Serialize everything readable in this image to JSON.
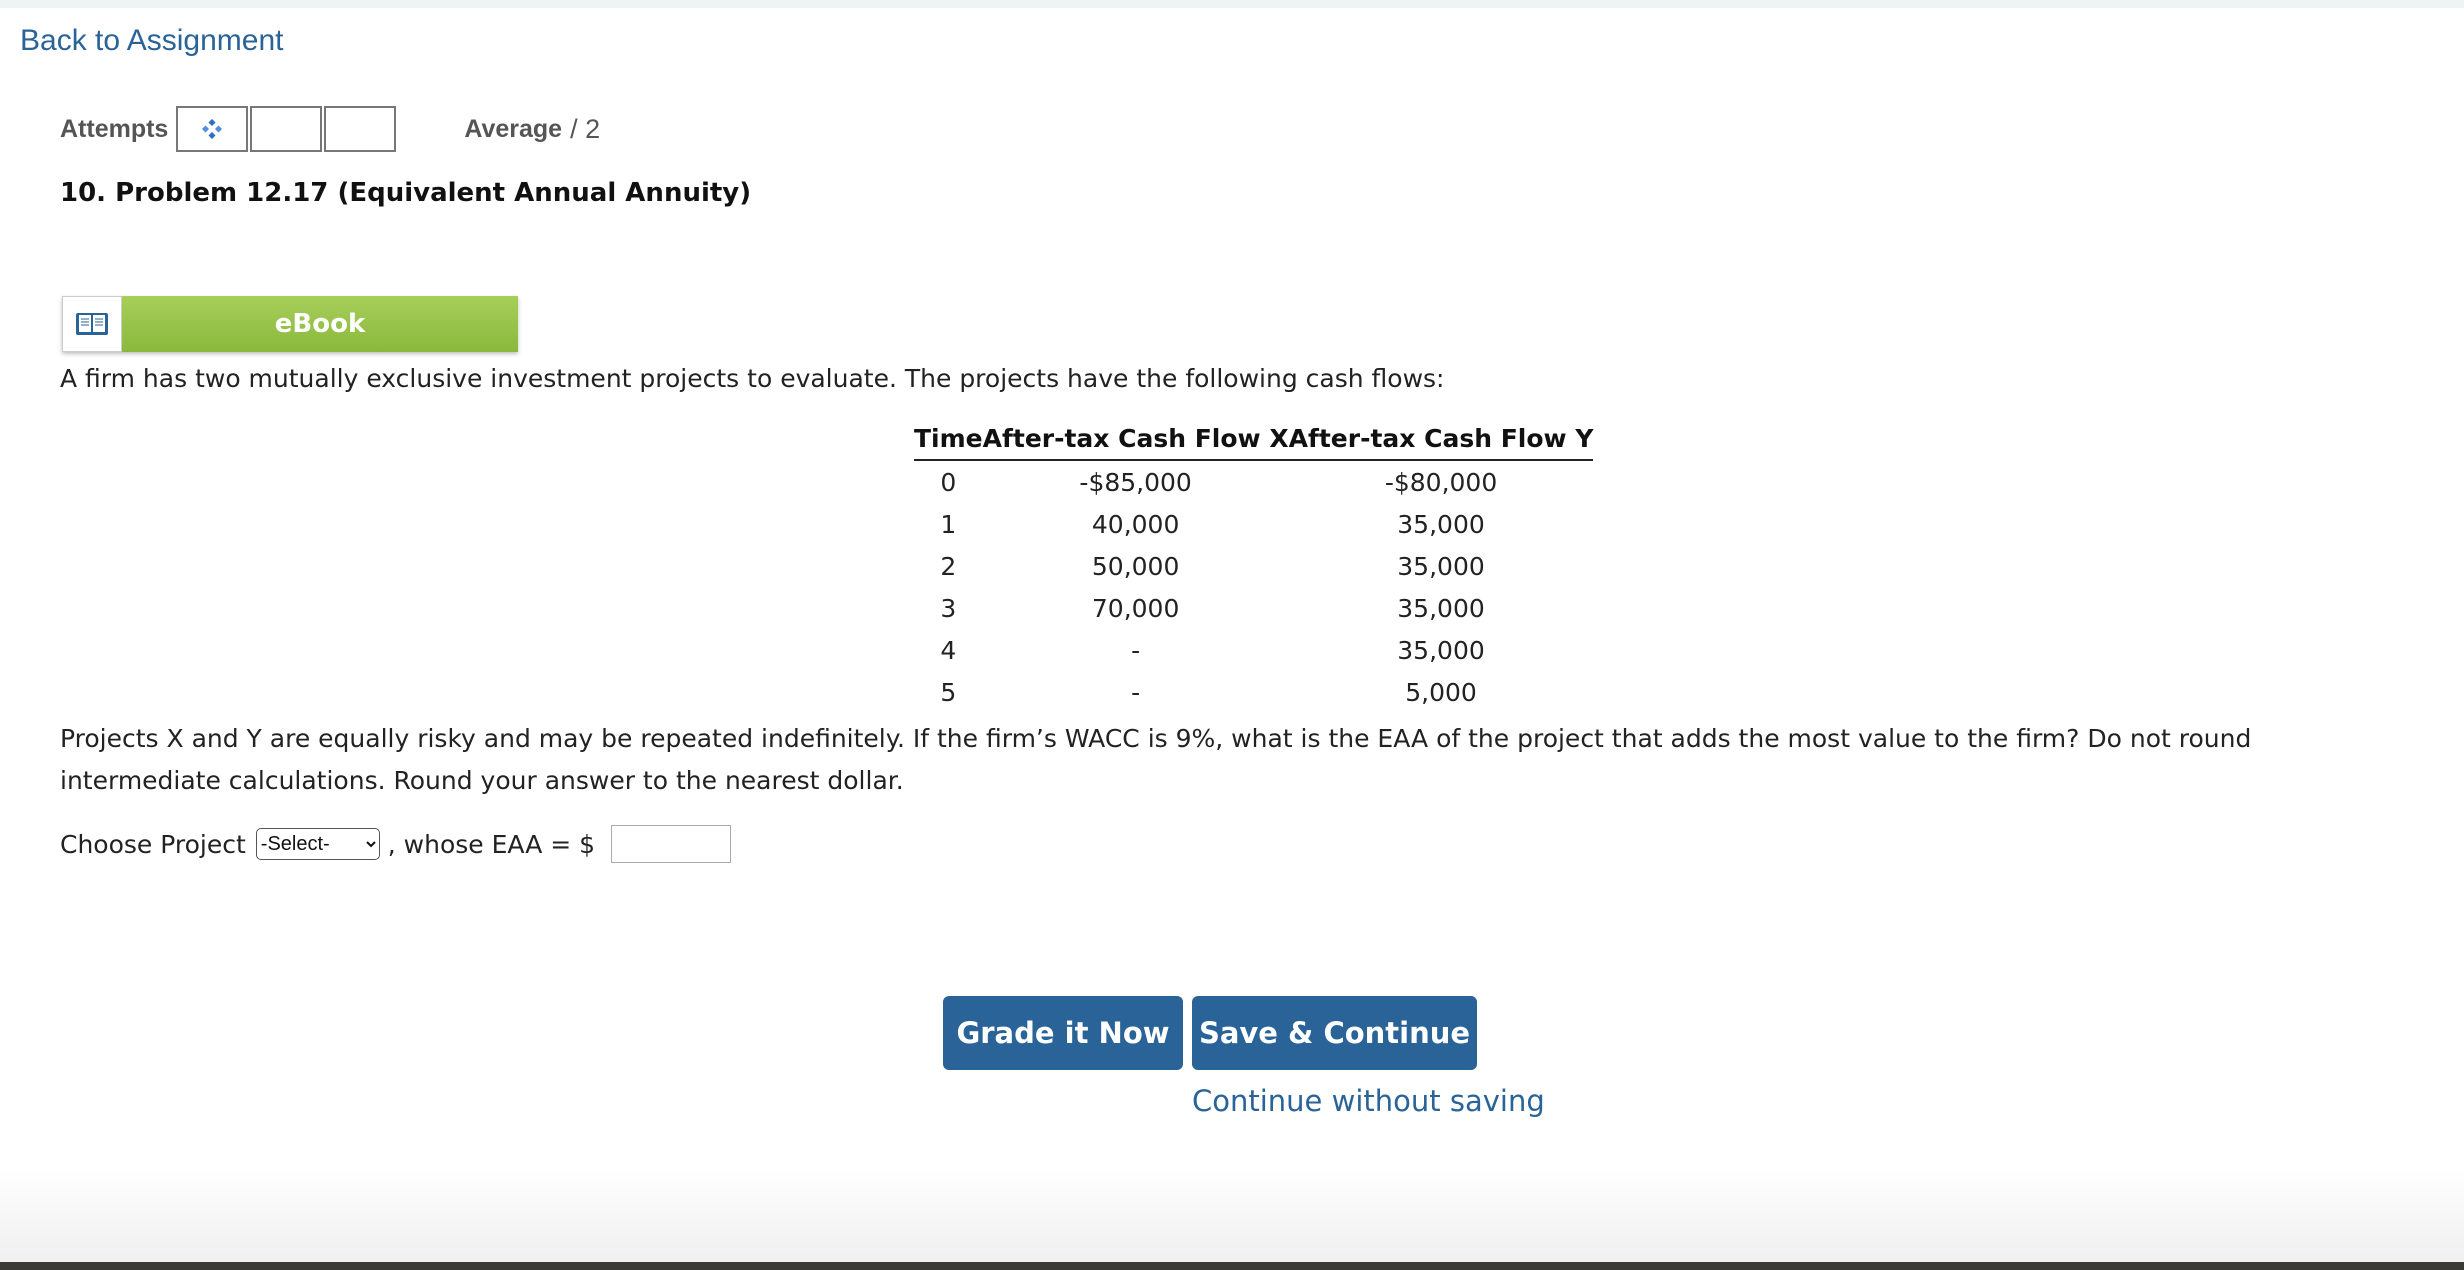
{
  "nav": {
    "back_link": "Back to Assignment"
  },
  "attempts": {
    "label": "Attempts",
    "average_label": "Average",
    "average_value": "/ 2"
  },
  "problem": {
    "title": "10.  Problem 12.17 (Equivalent Annual Annuity)",
    "ebook_label": "eBook",
    "intro": "A firm has two mutually exclusive investment projects to evaluate. The projects have the following cash flows:",
    "table": {
      "headers": [
        "Time",
        "After-tax Cash Flow X",
        "After-tax Cash Flow Y"
      ],
      "rows": [
        [
          "0",
          "-$85,000",
          "-$80,000"
        ],
        [
          "1",
          "40,000",
          "35,000"
        ],
        [
          "2",
          "50,000",
          "35,000"
        ],
        [
          "3",
          "70,000",
          "35,000"
        ],
        [
          "4",
          "-",
          "35,000"
        ],
        [
          "5",
          "-",
          "5,000"
        ]
      ]
    },
    "question": "Projects X and Y are equally risky and may be repeated indefinitely. If the firm’s WACC is 9%, what is the EAA of the project that adds the most value to the firm? Do not round intermediate calculations. Round your answer to the nearest dollar."
  },
  "answer": {
    "choose_label": "Choose Project",
    "select_value": "-Select-",
    "eaa_label": ", whose EAA = $",
    "eaa_value": ""
  },
  "actions": {
    "grade_label": "Grade it Now",
    "save_label": "Save & Continue",
    "continue_label": "Continue without saving"
  },
  "colors": {
    "link_blue": "#2a6398",
    "ebook_green": "#9bc64a"
  }
}
